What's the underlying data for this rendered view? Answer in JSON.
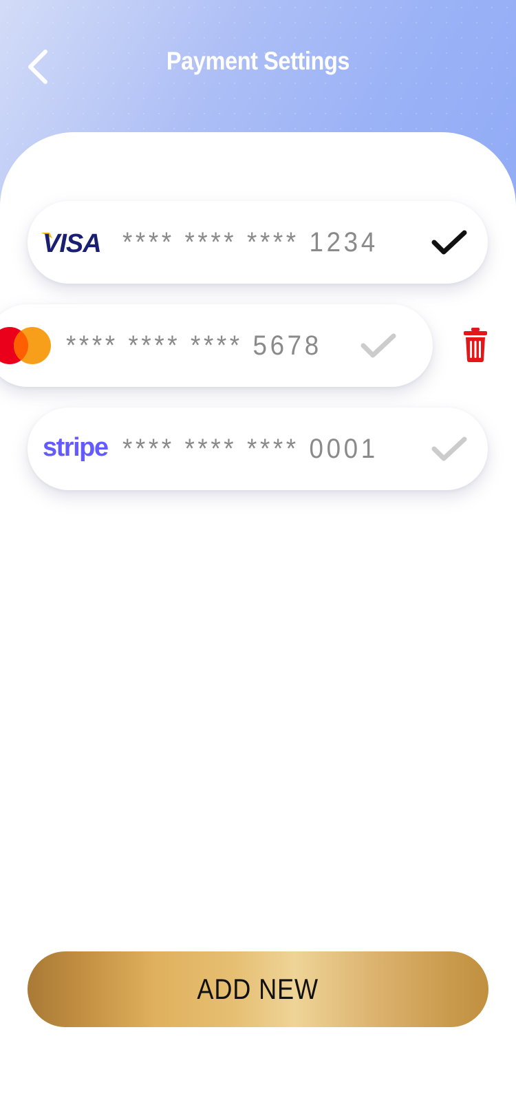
{
  "header": {
    "title": "Payment Settings",
    "back_icon": "chevron-left-icon"
  },
  "cards": [
    {
      "brand": "VISA",
      "number": "**** **** **** 1234",
      "selected": true,
      "check_color": "#111111"
    },
    {
      "brand": "mastercard",
      "number": "**** **** **** 5678",
      "selected": false,
      "check_color": "#cccccc",
      "swiped": true,
      "delete_icon": "trash-icon",
      "delete_color": "#e5161a"
    },
    {
      "brand": "stripe",
      "number": "**** **** **** 0001",
      "selected": false,
      "check_color": "#cccccc"
    }
  ],
  "actions": {
    "add_new_label": "ADD NEW"
  },
  "colors": {
    "header_gradient_start": "#d3dcf7",
    "header_gradient_end": "#91abf6",
    "visa_blue": "#1a1f71",
    "visa_gold": "#f7b600",
    "mastercard_red": "#eb001b",
    "mastercard_orange": "#f79e1b",
    "stripe_purple": "#635bff",
    "gold_button": "#e0b15e"
  }
}
